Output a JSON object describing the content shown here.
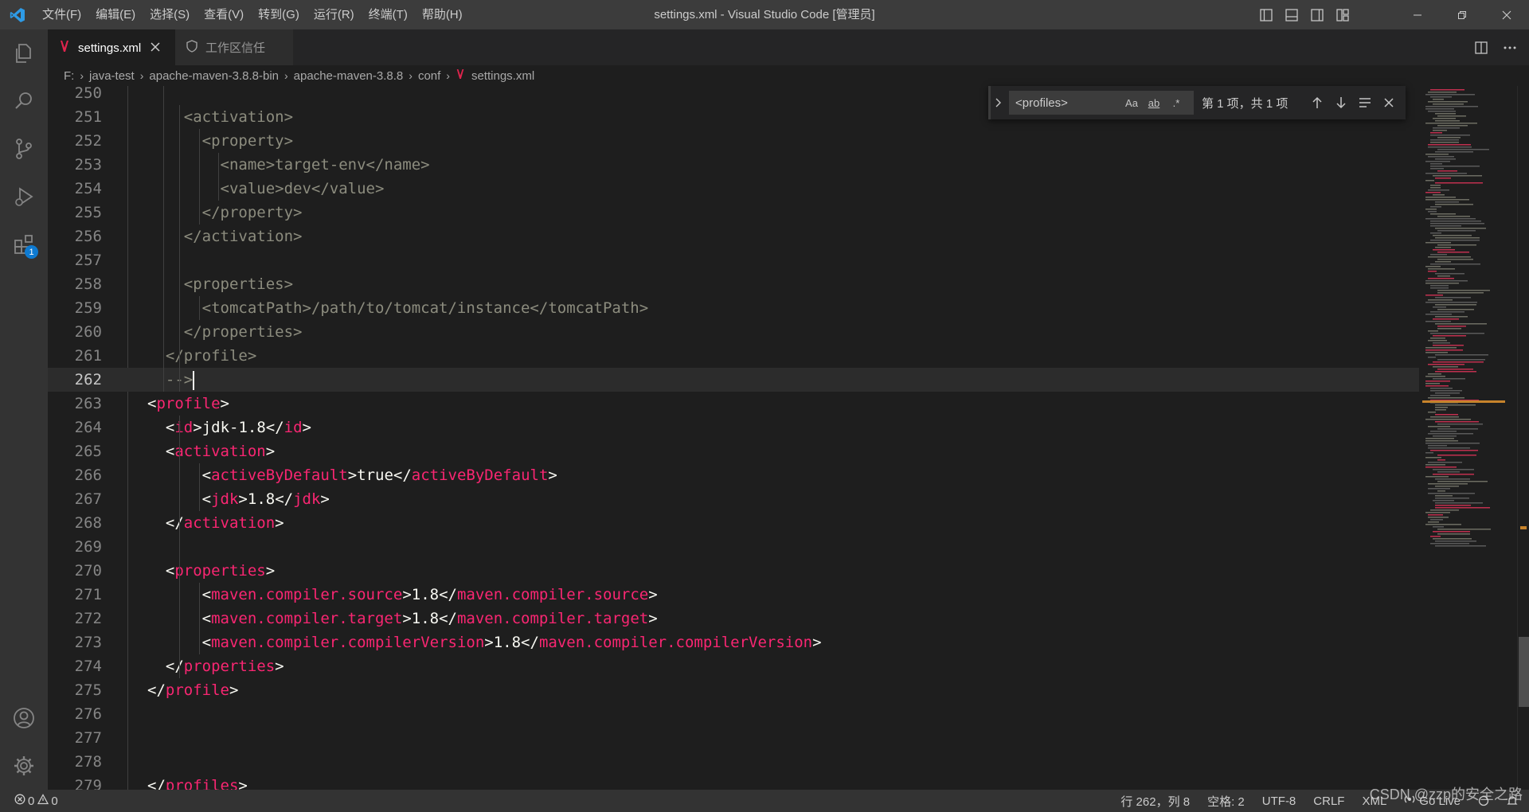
{
  "title_bar": {
    "menu": [
      "文件(F)",
      "编辑(E)",
      "选择(S)",
      "查看(V)",
      "转到(G)",
      "运行(R)",
      "终端(T)",
      "帮助(H)"
    ],
    "window_title": "settings.xml - Visual Studio Code [管理员]"
  },
  "activity_bar": {
    "extensions_badge": "1"
  },
  "tabs": [
    {
      "label": "settings.xml",
      "active": true,
      "icon": "maven-icon"
    },
    {
      "label": "工作区信任",
      "active": false,
      "icon": "shield-icon"
    }
  ],
  "breadcrumb": [
    "F:",
    "java-test",
    "apache-maven-3.8.8-bin",
    "apache-maven-3.8.8",
    "conf",
    "settings.xml"
  ],
  "find_widget": {
    "query": "<profiles>",
    "case_label": "Aa",
    "word_label": "ab",
    "regex_label": ".*",
    "match_status": "第 1 项，共 1 项"
  },
  "editor": {
    "current_line": 262,
    "lines": [
      {
        "n": "250",
        "s": ""
      },
      {
        "n": "251",
        "s": "    <activation>"
      },
      {
        "n": "252",
        "s": "      <property>"
      },
      {
        "n": "253",
        "s": "        <name>target-env</name>"
      },
      {
        "n": "254",
        "s": "        <value>dev</value>"
      },
      {
        "n": "255",
        "s": "      </property>"
      },
      {
        "n": "256",
        "s": "    </activation>"
      },
      {
        "n": "257",
        "s": ""
      },
      {
        "n": "258",
        "s": "    <properties>"
      },
      {
        "n": "259",
        "s": "      <tomcatPath>/path/to/tomcat/instance</tomcatPath>"
      },
      {
        "n": "260",
        "s": "    </properties>"
      },
      {
        "n": "261",
        "s": "  </profile>"
      },
      {
        "n": "262",
        "s": "  -->"
      },
      {
        "n": "263",
        "s": "<profile>"
      },
      {
        "n": "264",
        "s": "  <id>jdk-1.8</id>"
      },
      {
        "n": "265",
        "s": "  <activation>"
      },
      {
        "n": "266",
        "s": "      <activeByDefault>true</activeByDefault>"
      },
      {
        "n": "267",
        "s": "      <jdk>1.8</jdk>"
      },
      {
        "n": "268",
        "s": "  </activation>"
      },
      {
        "n": "269",
        "s": ""
      },
      {
        "n": "270",
        "s": "  <properties>"
      },
      {
        "n": "271",
        "s": "      <maven.compiler.source>1.8</maven.compiler.source>"
      },
      {
        "n": "272",
        "s": "      <maven.compiler.target>1.8</maven.compiler.target>"
      },
      {
        "n": "273",
        "s": "      <maven.compiler.compilerVersion>1.8</maven.compiler.compilerVersion>"
      },
      {
        "n": "274",
        "s": "  </properties>"
      },
      {
        "n": "275",
        "s": "</profile>"
      },
      {
        "n": "276",
        "s": ""
      },
      {
        "n": "277",
        "s": ""
      },
      {
        "n": "278",
        "s": ""
      },
      {
        "n": "279",
        "s": "</profiles>"
      }
    ]
  },
  "status_bar": {
    "errors": "0",
    "warnings": "0",
    "position": "行 262，列 8",
    "spaces": "空格: 2",
    "encoding": "UTF-8",
    "eol": "CRLF",
    "language": "XML",
    "go_live": "Go Live",
    "watermark": "CSDN @zzp的安全之路"
  },
  "colors": {
    "tag": "#f92672",
    "comment": "#8c8c7e",
    "text": "#f8f8f2",
    "background": "#1e1e1e",
    "current_line": "#2c2c2c",
    "accent_badge": "#0e7ad1"
  }
}
